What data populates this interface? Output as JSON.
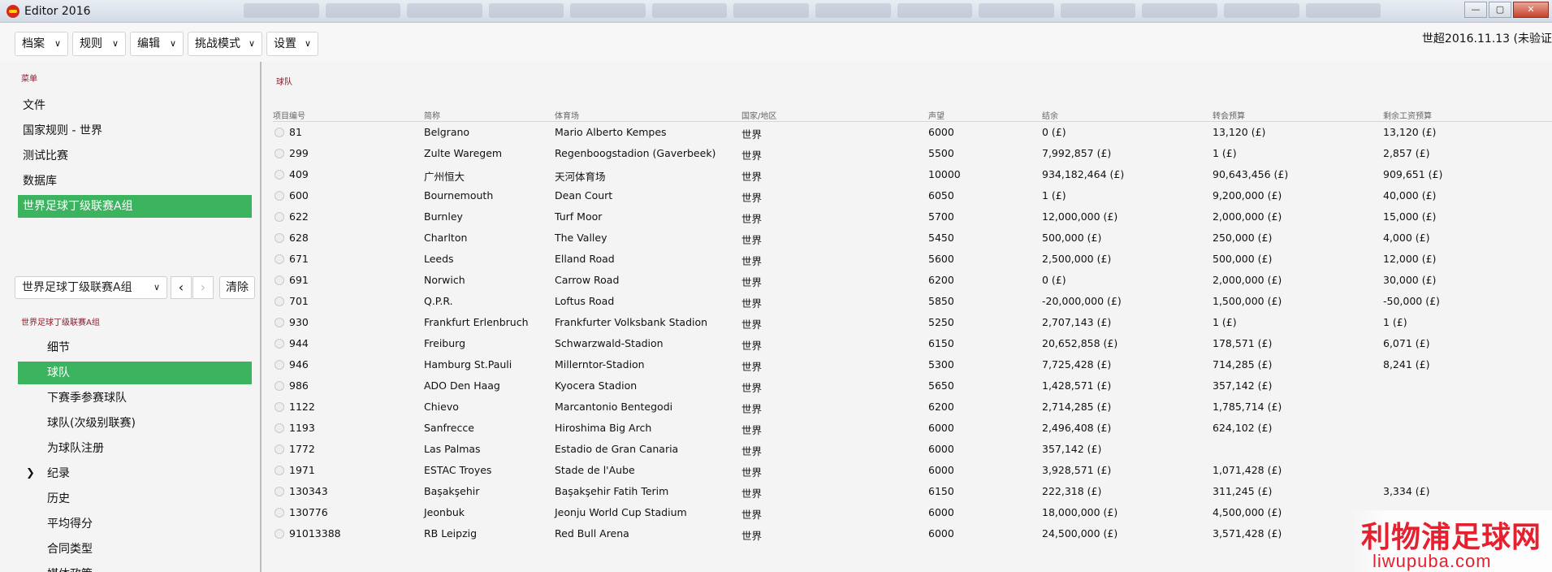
{
  "window": {
    "title": "Editor 2016",
    "buttons": [
      "—",
      "▢",
      "✕"
    ]
  },
  "toolbar": {
    "menus": [
      "档案",
      "规则",
      "编辑",
      "挑战模式",
      "设置"
    ],
    "version": "世超2016.11.13 (未验证"
  },
  "sidebar": {
    "menu_label": "菜单",
    "items": [
      "文件",
      "国家规则 - 世界",
      "测试比赛",
      "数据库",
      "世界足球丁级联赛A组"
    ],
    "league_select": "世界足球丁级联赛A组",
    "clear": "清除",
    "league_label": "世界足球丁级联赛A组",
    "sub_items": [
      "细节",
      "球队",
      "下赛季参赛球队",
      "球队(次级别联赛)",
      "为球队注册",
      "纪录",
      "历史",
      "平均得分",
      "合同类型",
      "媒体政策"
    ]
  },
  "main": {
    "title": "球队",
    "columns": [
      "项目编号",
      "简称",
      "体育场",
      "国家/地区",
      "声望",
      "结余",
      "转会预算",
      "剩余工资预算"
    ],
    "rows": [
      [
        "81",
        "Belgrano",
        "Mario Alberto Kempes",
        "世界",
        "6000",
        "0 (£)",
        "13,120 (£)",
        "13,120 (£)"
      ],
      [
        "299",
        "Zulte Waregem",
        "Regenboogstadion (Gaverbeek)",
        "世界",
        "5500",
        "7,992,857 (£)",
        "1 (£)",
        "2,857 (£)"
      ],
      [
        "409",
        "广州恒大",
        "天河体育场",
        "世界",
        "10000",
        "934,182,464 (£)",
        "90,643,456 (£)",
        "909,651 (£)"
      ],
      [
        "600",
        "Bournemouth",
        "Dean Court",
        "世界",
        "6050",
        "1 (£)",
        "9,200,000 (£)",
        "40,000 (£)"
      ],
      [
        "622",
        "Burnley",
        "Turf Moor",
        "世界",
        "5700",
        "12,000,000 (£)",
        "2,000,000 (£)",
        "15,000 (£)"
      ],
      [
        "628",
        "Charlton",
        "The Valley",
        "世界",
        "5450",
        "500,000 (£)",
        "250,000 (£)",
        "4,000 (£)"
      ],
      [
        "671",
        "Leeds",
        "Elland Road",
        "世界",
        "5600",
        "2,500,000 (£)",
        "500,000 (£)",
        "12,000 (£)"
      ],
      [
        "691",
        "Norwich",
        "Carrow Road",
        "世界",
        "6200",
        "0 (£)",
        "2,000,000 (£)",
        "30,000 (£)"
      ],
      [
        "701",
        "Q.P.R.",
        "Loftus Road",
        "世界",
        "5850",
        "-20,000,000 (£)",
        "1,500,000 (£)",
        "-50,000 (£)"
      ],
      [
        "930",
        "Frankfurt Erlenbruch",
        "Frankfurter Volksbank Stadion",
        "世界",
        "5250",
        "2,707,143 (£)",
        "1 (£)",
        "1 (£)"
      ],
      [
        "944",
        "Freiburg",
        "Schwarzwald-Stadion",
        "世界",
        "6150",
        "20,652,858 (£)",
        "178,571 (£)",
        "6,071 (£)"
      ],
      [
        "946",
        "Hamburg St.Pauli",
        "Millerntor-Stadion",
        "世界",
        "5300",
        "7,725,428 (£)",
        "714,285 (£)",
        "8,241 (£)"
      ],
      [
        "986",
        "ADO Den Haag",
        "Kyocera Stadion",
        "世界",
        "5650",
        "1,428,571 (£)",
        "357,142 (£)",
        ""
      ],
      [
        "1122",
        "Chievo",
        "Marcantonio Bentegodi",
        "世界",
        "6200",
        "2,714,285 (£)",
        "1,785,714 (£)",
        ""
      ],
      [
        "1193",
        "Sanfrecce",
        "Hiroshima Big Arch",
        "世界",
        "6000",
        "2,496,408 (£)",
        "624,102 (£)",
        ""
      ],
      [
        "1772",
        "Las Palmas",
        "Estadio de Gran Canaria",
        "世界",
        "6000",
        "357,142 (£)",
        "",
        ""
      ],
      [
        "1971",
        "ESTAC Troyes",
        "Stade de l'Aube",
        "世界",
        "6000",
        "3,928,571 (£)",
        "1,071,428 (£)",
        ""
      ],
      [
        "130343",
        "Başakşehir",
        "Başakşehir Fatih Terim",
        "世界",
        "6150",
        "222,318 (£)",
        "311,245 (£)",
        "3,334 (£)"
      ],
      [
        "130776",
        "Jeonbuk",
        "Jeonju World Cup Stadium",
        "世界",
        "6000",
        "18,000,000 (£)",
        "4,500,000 (£)",
        ""
      ],
      [
        "91013388",
        "RB Leipzig",
        "Red Bull Arena",
        "世界",
        "6000",
        "24,500,000 (£)",
        "3,571,428 (£)",
        ""
      ]
    ]
  },
  "watermark": {
    "text": "利物浦足球网",
    "url": "liwupuba.com"
  }
}
